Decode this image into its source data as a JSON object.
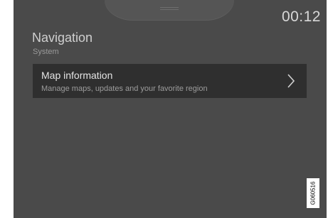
{
  "status_bar": {
    "clock": "00:12"
  },
  "header": {
    "title": "Navigation",
    "subtitle": "System"
  },
  "list": {
    "items": [
      {
        "title": "Map information",
        "description": "Manage maps, updates and your favorite region",
        "icon": "chevron-right-icon"
      }
    ]
  },
  "figure_ref": "G060516",
  "colors": {
    "screen_background": "#4a4a4a",
    "list_item_background": "#2f2f2f",
    "text_primary": "#e4e4e4",
    "text_secondary": "#9c9c9c"
  }
}
